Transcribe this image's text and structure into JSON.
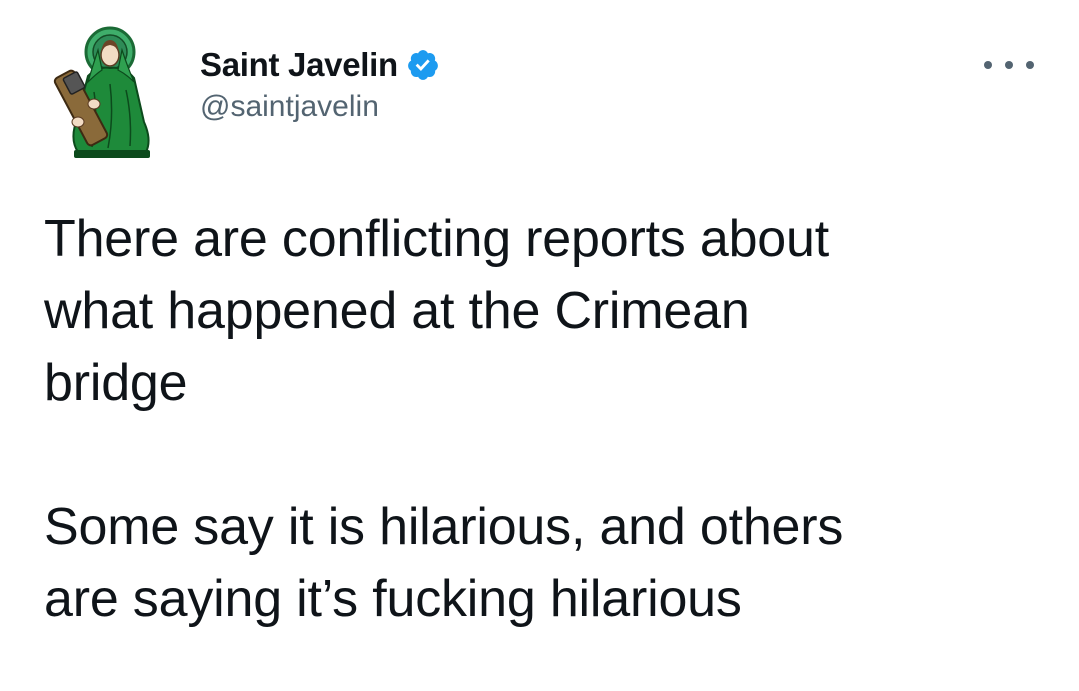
{
  "tweet": {
    "author": {
      "display_name": "Saint Javelin",
      "handle": "@saintjavelin",
      "verified": true,
      "verified_color": "#1d9bf0"
    },
    "more_icon": "more-horizontal-icon",
    "text_paragraphs": [
      "There are conflicting reports about\nwhat happened at the Crimean\nbridge",
      "Some say it is hilarious, and others\nare saying it’s fucking hilarious"
    ]
  },
  "colors": {
    "text_primary": "#0f1419",
    "text_secondary": "#536471",
    "avatar_robe": "#1e8a3a",
    "avatar_halo": "#3fae6b"
  }
}
